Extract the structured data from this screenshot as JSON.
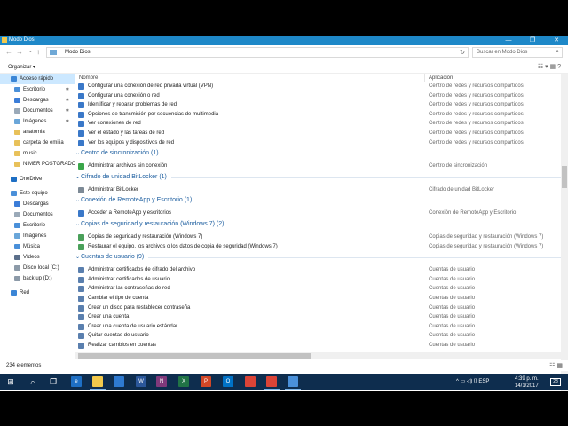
{
  "window": {
    "title": "Modo Dios",
    "min_glyph": "—",
    "max_glyph": "❐",
    "close_glyph": "✕"
  },
  "address": {
    "back_glyph": "←",
    "forward_glyph": "→",
    "down_glyph": "⌄",
    "up_glyph": "↑",
    "path": "Modo Dios",
    "refresh_glyph": "↻",
    "search_placeholder": "Buscar en Modo Dios",
    "search_glyph": "⌕"
  },
  "commandbar": {
    "organize": "Organizar ▾",
    "view_glyphs": "☷ ▾     ▦  ?"
  },
  "nav": [
    {
      "label": "Acceso rápido",
      "icon": "star-icon",
      "color": "#3b86d6",
      "pinned": false,
      "selected": true,
      "indent": 12
    },
    {
      "label": "Escritorio",
      "icon": "desktop-icon",
      "color": "#4a90d9",
      "pinned": true,
      "indent": 16
    },
    {
      "label": "Descargas",
      "icon": "download-icon",
      "color": "#3b7dd8",
      "pinned": true,
      "indent": 16
    },
    {
      "label": "Documentos",
      "icon": "documents-icon",
      "color": "#9aa9b8",
      "pinned": true,
      "indent": 16
    },
    {
      "label": "Imágenes",
      "icon": "pictures-icon",
      "color": "#6aa6d9",
      "pinned": true,
      "indent": 16
    },
    {
      "label": "anatomia",
      "icon": "folder-icon",
      "color": "#e8c15a",
      "indent": 16
    },
    {
      "label": "carpeta de emilia",
      "icon": "folder-icon",
      "color": "#e8c15a",
      "indent": 16
    },
    {
      "label": "music",
      "icon": "folder-icon",
      "color": "#e8c15a",
      "indent": 16
    },
    {
      "label": "NIMER POSTGRADO",
      "icon": "folder-icon",
      "color": "#e8c15a",
      "indent": 16
    },
    {
      "label": "OneDrive",
      "icon": "cloud-icon",
      "color": "#1e6fc4",
      "indent": 12
    },
    {
      "label": "Este equipo",
      "icon": "computer-icon",
      "color": "#4a90d9",
      "indent": 12
    },
    {
      "label": "Descargas",
      "icon": "download-icon",
      "color": "#3b7dd8",
      "indent": 16
    },
    {
      "label": "Documentos",
      "icon": "documents-icon",
      "color": "#9aa9b8",
      "indent": 16
    },
    {
      "label": "Escritorio",
      "icon": "desktop-icon",
      "color": "#4a90d9",
      "indent": 16
    },
    {
      "label": "Imágenes",
      "icon": "pictures-icon",
      "color": "#6aa6d9",
      "indent": 16
    },
    {
      "label": "Música",
      "icon": "music-icon",
      "color": "#4a90d9",
      "indent": 16
    },
    {
      "label": "Vídeos",
      "icon": "videos-icon",
      "color": "#5b6f8a",
      "indent": 16
    },
    {
      "label": "Disco local (C:)",
      "icon": "drive-icon",
      "color": "#8c9aa8",
      "indent": 16
    },
    {
      "label": "back up (D:)",
      "icon": "drive-icon",
      "color": "#8c9aa8",
      "indent": 16
    },
    {
      "label": "Red",
      "icon": "network-icon",
      "color": "#3b86d6",
      "indent": 12
    }
  ],
  "columns": {
    "name": "Nombre",
    "app": "Aplicación",
    "sort_glyph": "^"
  },
  "list": [
    {
      "type": "item",
      "label": "Configurar una conexión de red privada virtual (VPN)",
      "app": "Centro de redes y recursos compartidos",
      "color": "#3a78c8"
    },
    {
      "type": "item",
      "label": "Configurar una conexión o red",
      "app": "Centro de redes y recursos compartidos",
      "color": "#3a78c8"
    },
    {
      "type": "item",
      "label": "Identificar y reparar problemas de red",
      "app": "Centro de redes y recursos compartidos",
      "color": "#3a78c8"
    },
    {
      "type": "item",
      "label": "Opciones de transmisión por secuencias de multimedia",
      "app": "Centro de redes y recursos compartidos",
      "color": "#3a78c8"
    },
    {
      "type": "item",
      "label": "Ver conexiones de red",
      "app": "Centro de redes y recursos compartidos",
      "color": "#3a78c8"
    },
    {
      "type": "item",
      "label": "Ver el estado y las tareas de red",
      "app": "Centro de redes y recursos compartidos",
      "color": "#3a78c8"
    },
    {
      "type": "item",
      "label": "Ver los equipos y dispositivos de red",
      "app": "Centro de redes y recursos compartidos",
      "color": "#3a78c8"
    },
    {
      "type": "group",
      "label": "Centro de sincronización (1)"
    },
    {
      "type": "item",
      "label": "Administrar archivos sin conexión",
      "app": "Centro de sincronización",
      "color": "#3aa64a"
    },
    {
      "type": "group",
      "label": "Cifrado de unidad BitLocker (1)"
    },
    {
      "type": "item",
      "label": "Administrar BitLocker",
      "app": "Cifrado de unidad BitLocker",
      "color": "#7d8a96"
    },
    {
      "type": "group",
      "label": "Conexión de RemoteApp y Escritorio (1)"
    },
    {
      "type": "item",
      "label": "Acceder a RemoteApp y escritorios",
      "app": "Conexión de RemoteApp y Escritorio",
      "color": "#3a78c8"
    },
    {
      "type": "group",
      "label": "Copias de seguridad y restauración (Windows 7) (2)"
    },
    {
      "type": "item",
      "label": "Copias de seguridad y restauración (Windows 7)",
      "app": "Copias de seguridad y restauración (Windows 7)",
      "color": "#4aa05a"
    },
    {
      "type": "item",
      "label": "Restaurar el equipo, los archivos o los datos de copia de seguridad (Windows 7)",
      "app": "Copias de seguridad y restauración (Windows 7)",
      "color": "#4aa05a"
    },
    {
      "type": "group",
      "label": "Cuentas de usuario (9)"
    },
    {
      "type": "item",
      "label": "Administrar certificados de cifrado del archivo",
      "app": "Cuentas de usuario",
      "color": "#5a7fae"
    },
    {
      "type": "item",
      "label": "Administrar certificados de usuario",
      "app": "Cuentas de usuario",
      "color": "#5a7fae"
    },
    {
      "type": "item",
      "label": "Administrar las contraseñas de red",
      "app": "Cuentas de usuario",
      "color": "#5a7fae"
    },
    {
      "type": "item",
      "label": "Cambiar el tipo de cuenta",
      "app": "Cuentas de usuario",
      "color": "#5a7fae"
    },
    {
      "type": "item",
      "label": "Crear un disco para restablecer contraseña",
      "app": "Cuentas de usuario",
      "color": "#5a7fae"
    },
    {
      "type": "item",
      "label": "Crear una cuenta",
      "app": "Cuentas de usuario",
      "color": "#5a7fae"
    },
    {
      "type": "item",
      "label": "Crear una cuenta de usuario estándar",
      "app": "Cuentas de usuario",
      "color": "#5a7fae"
    },
    {
      "type": "item",
      "label": "Quitar cuentas de usuario",
      "app": "Cuentas de usuario",
      "color": "#5a7fae"
    },
    {
      "type": "item",
      "label": "Realizar cambios en cuentas",
      "app": "Cuentas de usuario",
      "color": "#5a7fae"
    }
  ],
  "status": {
    "count": "234 elementos",
    "view_glyphs": "☷ ▦"
  },
  "taskbar": {
    "apps": [
      {
        "name": "start-icon",
        "glyph": "⊞",
        "color": "transparent"
      },
      {
        "name": "search-icon",
        "glyph": "⌕",
        "color": "transparent"
      },
      {
        "name": "task-view-icon",
        "glyph": "❐",
        "color": "transparent"
      },
      {
        "name": "edge-icon",
        "glyph": "e",
        "color": "#1e6fc4"
      },
      {
        "name": "file-explorer-icon",
        "glyph": "",
        "color": "#f2c94c"
      },
      {
        "name": "store-icon",
        "glyph": "",
        "color": "#2e7ad1"
      },
      {
        "name": "word-icon",
        "glyph": "W",
        "color": "#2b579a"
      },
      {
        "name": "onenote-icon",
        "glyph": "N",
        "color": "#80397b"
      },
      {
        "name": "excel-icon",
        "glyph": "X",
        "color": "#217346"
      },
      {
        "name": "powerpoint-icon",
        "glyph": "P",
        "color": "#d24726"
      },
      {
        "name": "outlook-icon",
        "glyph": "O",
        "color": "#0072c6"
      },
      {
        "name": "chrome-icon",
        "glyph": "",
        "color": "#db4437"
      },
      {
        "name": "chrome-icon-2",
        "glyph": "",
        "color": "#db4437"
      },
      {
        "name": "app-window-icon",
        "glyph": "",
        "color": "#4a90d9"
      }
    ],
    "tray": "^  ▭  ◁)  ⌷  ESP",
    "time": "4:39 p. m.",
    "date": "14/1/2017",
    "notify": "23"
  }
}
